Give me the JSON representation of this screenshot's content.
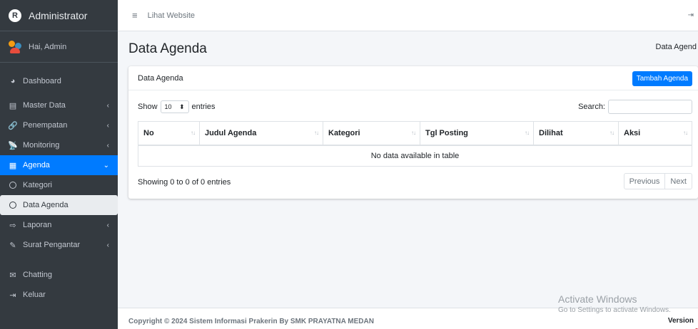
{
  "sidebar": {
    "brand": "Administrator",
    "brand_logo": "R",
    "user": "Hai, Admin",
    "items": [
      {
        "label": "Dashboard",
        "icon": "dashboard-icon",
        "glyph": "◕"
      },
      {
        "label": "Master Data",
        "icon": "database-icon",
        "glyph": "▤",
        "chevron": "‹"
      },
      {
        "label": "Penempatan",
        "icon": "link-icon",
        "glyph": "🔗",
        "chevron": "‹"
      },
      {
        "label": "Monitoring",
        "icon": "satellite-icon",
        "glyph": "📡",
        "chevron": "‹"
      },
      {
        "label": "Agenda",
        "icon": "calendar-icon",
        "glyph": "▦",
        "chevron": "⌄"
      },
      {
        "label": "Kategori"
      },
      {
        "label": "Data Agenda"
      },
      {
        "label": "Laporan",
        "icon": "file-export-icon",
        "glyph": "⇨",
        "chevron": "‹"
      },
      {
        "label": "Surat Pengantar",
        "icon": "file-signature-icon",
        "glyph": "✎",
        "chevron": "‹"
      },
      {
        "label": "Chatting",
        "icon": "envelope-icon",
        "glyph": "✉"
      },
      {
        "label": "Keluar",
        "icon": "sign-out-icon",
        "glyph": "⇥"
      }
    ]
  },
  "topbar": {
    "menu_glyph": "≡",
    "link": "Lihat Website",
    "logout_glyph": "⇥"
  },
  "header": {
    "title": "Data Agenda",
    "breadcrumb": "Data Agend"
  },
  "card": {
    "title": "Data Agenda",
    "add_button": "Tambah Agenda",
    "show_label": "Show",
    "entries_value": "10",
    "entries_label": "entries",
    "search_label": "Search:",
    "search_value": "",
    "columns": [
      "No",
      "Judul Agenda",
      "Kategori",
      "Tgl Posting",
      "Dilihat",
      "Aksi"
    ],
    "empty_message": "No data available in table",
    "info": "Showing 0 to 0 of 0 entries",
    "prev": "Previous",
    "next": "Next"
  },
  "footer": {
    "copyright": "Copyright © 2024 Sistem Informasi Prakerin By SMK PRAYATNA MEDAN",
    "version": "Version"
  },
  "watermark": {
    "line1": "Activate Windows",
    "line2": "Go to Settings to activate Windows."
  },
  "colors": {
    "sidebar_bg": "#343a40",
    "accent": "#007bff",
    "content_bg": "#f4f6f9"
  }
}
